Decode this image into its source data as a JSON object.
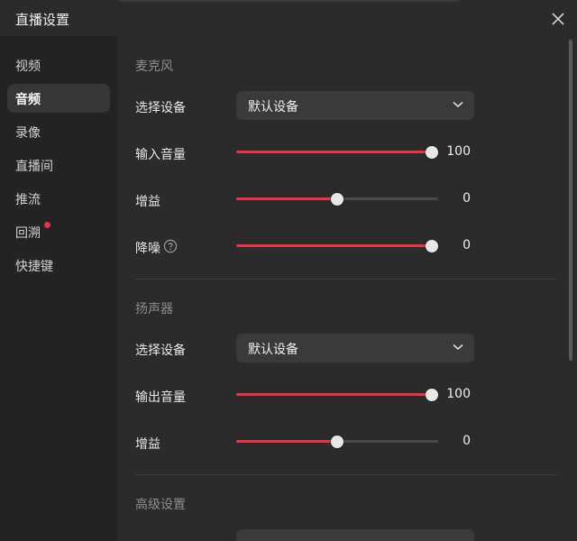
{
  "dialog": {
    "title": "直播设置"
  },
  "sidebar": {
    "items": [
      {
        "label": "视频"
      },
      {
        "label": "音频"
      },
      {
        "label": "录像"
      },
      {
        "label": "直播间"
      },
      {
        "label": "推流"
      },
      {
        "label": "回溯"
      },
      {
        "label": "快捷键"
      }
    ],
    "active_index": 1,
    "badge_on_index": 5
  },
  "microphone": {
    "section_title": "麦克风",
    "device_label": "选择设备",
    "device_value": "默认设备",
    "input_volume_label": "输入音量",
    "input_volume_value": "100",
    "input_volume_level": 1.0,
    "gain_label": "增益",
    "gain_value": "0",
    "gain_level": 0.5,
    "noise_label": "降噪",
    "noise_value": "0",
    "noise_level": 1.0
  },
  "speaker": {
    "section_title": "扬声器",
    "device_label": "选择设备",
    "device_value": "默认设备",
    "output_volume_label": "输出音量",
    "output_volume_value": "100",
    "output_volume_level": 1.0,
    "gain_label": "增益",
    "gain_value": "0",
    "gain_level": 0.5
  },
  "advanced": {
    "section_title": "高级设置"
  },
  "colors": {
    "accent": "#e8334b",
    "background": "#2b2b2b",
    "sidebar": "#242424",
    "control": "#3a3a3a"
  },
  "icons": {
    "close": "close-icon",
    "dropdown": "chevron-down-icon",
    "help": "question-circle-icon"
  }
}
